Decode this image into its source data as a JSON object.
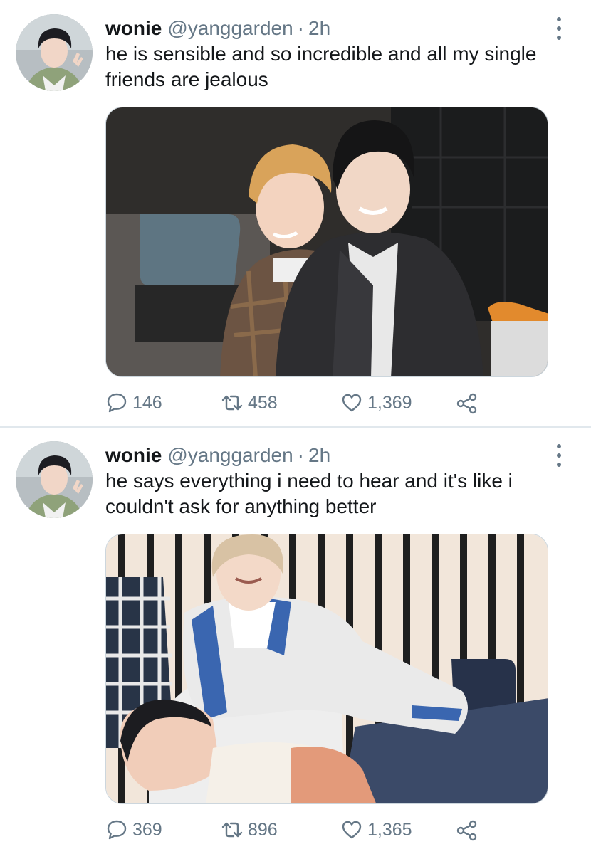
{
  "tweets": [
    {
      "user": {
        "name": "wonie",
        "handle": "@yanggarden",
        "separator": "·",
        "time": "2h"
      },
      "text": "he is sensible and so incredible and all my single friends are jealous",
      "stats": {
        "replies": "146",
        "retweets": "458",
        "likes": "1,369"
      }
    },
    {
      "user": {
        "name": "wonie",
        "handle": "@yanggarden",
        "separator": "·",
        "time": "2h"
      },
      "text": "he says everything i need to hear and it's like i couldn't ask for anything better",
      "stats": {
        "replies": "369",
        "retweets": "896",
        "likes": "1,365"
      }
    }
  ],
  "icons": {
    "reply": "speech-bubble-icon",
    "retweet": "retweet-arrows-icon",
    "like": "heart-outline-icon",
    "share": "share-nodes-icon",
    "more": "vertical-ellipsis-icon"
  },
  "colors": {
    "text": "#14171a",
    "secondary": "#657786",
    "divider": "#e1e8ed"
  }
}
